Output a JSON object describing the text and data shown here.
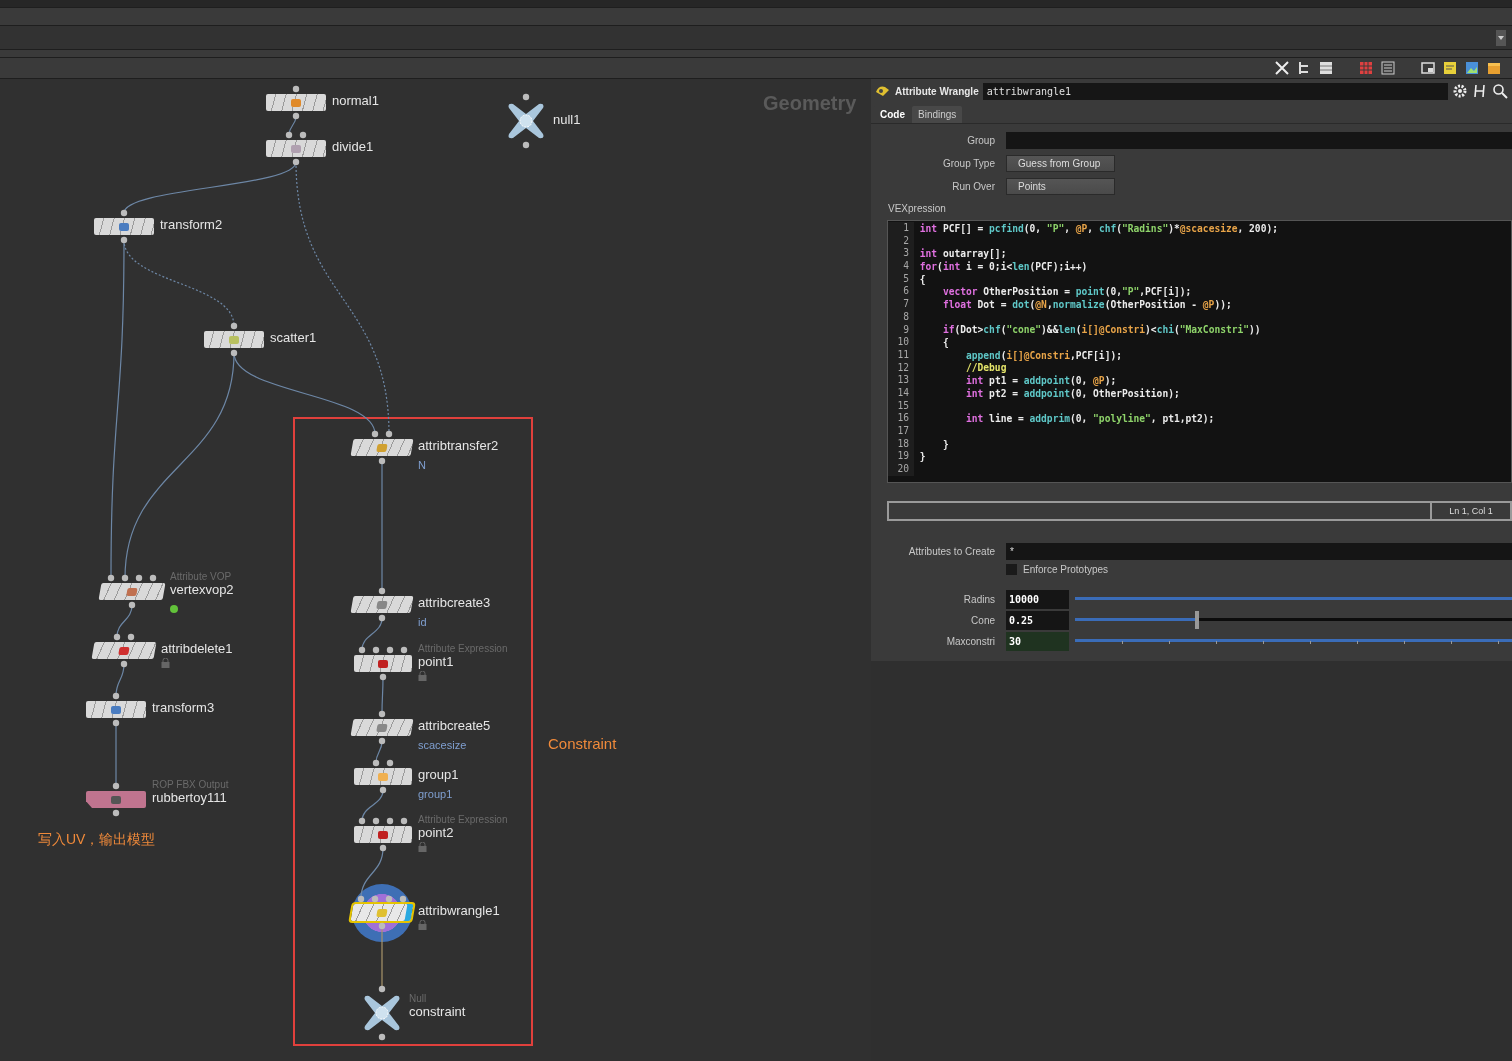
{
  "network": {
    "context": "Geometry",
    "box_label": "Constraint",
    "sticky_note": "写入UV，输出模型",
    "nodes": [
      {
        "name": "normal1",
        "kind": "box",
        "selected": false,
        "locked": false
      },
      {
        "name": "divide1",
        "kind": "box",
        "selected": false,
        "locked": false
      },
      {
        "name": "null1",
        "kind": "null",
        "selected": false,
        "locked": false
      },
      {
        "name": "transform2",
        "kind": "box",
        "selected": false,
        "locked": false
      },
      {
        "name": "scatter1",
        "kind": "box",
        "selected": false,
        "locked": false
      },
      {
        "name": "attribtransfer2",
        "kind": "slanted",
        "note": "N",
        "selected": false,
        "locked": false
      },
      {
        "name": "vertexvop2",
        "type": "Attribute VOP",
        "kind": "slanted",
        "badge": true,
        "selected": false,
        "locked": false
      },
      {
        "name": "attribdelete1",
        "kind": "slanted",
        "selected": false,
        "locked": true
      },
      {
        "name": "transform3",
        "kind": "box",
        "selected": false,
        "locked": false
      },
      {
        "name": "rubbertoy111",
        "type": "ROP FBX Output",
        "kind": "rop",
        "selected": false,
        "locked": false
      },
      {
        "name": "attribcreate3",
        "kind": "slanted",
        "note": "id",
        "selected": false,
        "locked": false
      },
      {
        "name": "point1",
        "type": "Attribute Expression",
        "kind": "box",
        "selected": false,
        "locked": true
      },
      {
        "name": "attribcreate5",
        "kind": "slanted",
        "note": "scacesize",
        "selected": false,
        "locked": false
      },
      {
        "name": "group1",
        "kind": "box",
        "note": "group1",
        "selected": false,
        "locked": false
      },
      {
        "name": "point2",
        "type": "Attribute Expression",
        "kind": "box",
        "selected": false,
        "locked": true
      },
      {
        "name": "attribwrangle1",
        "kind": "slanted",
        "selected": true,
        "locked": true
      },
      {
        "name": "constraint",
        "type": "Null",
        "kind": "null",
        "selected": false,
        "locked": false
      }
    ]
  },
  "parameters": {
    "node_type": "Attribute Wrangle",
    "node_name": "attribwrangle1",
    "tabs": [
      {
        "label": "Code",
        "selected": true
      },
      {
        "label": "Bindings",
        "selected": false
      }
    ],
    "group": {
      "label": "Group"
    },
    "group_type": {
      "label": "Group Type",
      "value": "Guess from Group"
    },
    "run_over": {
      "label": "Run Over",
      "value": "Points"
    },
    "vex_label": "VEXpression",
    "code_lines": [
      {
        "number": "1",
        "tokens": [
          {
            "kind": "keyword",
            "text": "int"
          },
          {
            "kind": "plain",
            "text": " PCF[] = "
          },
          {
            "kind": "function",
            "text": "pcfind"
          },
          {
            "kind": "plain",
            "text": "(0, "
          },
          {
            "kind": "string",
            "text": "\"P\""
          },
          {
            "kind": "plain",
            "text": ", "
          },
          {
            "kind": "attribute",
            "text": "@P"
          },
          {
            "kind": "plain",
            "text": ", "
          },
          {
            "kind": "function",
            "text": "chf"
          },
          {
            "kind": "plain",
            "text": "("
          },
          {
            "kind": "string",
            "text": "\"Radins\""
          },
          {
            "kind": "plain",
            "text": ")*"
          },
          {
            "kind": "attribute",
            "text": "@scacesize"
          },
          {
            "kind": "plain",
            "text": ", 200);"
          }
        ]
      },
      {
        "number": "2"
      },
      {
        "number": "3",
        "tokens": [
          {
            "kind": "keyword",
            "text": "int"
          },
          {
            "kind": "plain",
            "text": " outarray[];"
          }
        ]
      },
      {
        "number": "4",
        "tokens": [
          {
            "kind": "keyword",
            "text": "for"
          },
          {
            "kind": "plain",
            "text": "("
          },
          {
            "kind": "keyword",
            "text": "int"
          },
          {
            "kind": "plain",
            "text": " i = 0;i<"
          },
          {
            "kind": "function",
            "text": "len"
          },
          {
            "kind": "plain",
            "text": "(PCF);i++)"
          }
        ]
      },
      {
        "number": "5",
        "tokens": [
          {
            "kind": "plain",
            "text": "{"
          }
        ]
      },
      {
        "number": "6",
        "tokens": [
          {
            "kind": "keyword",
            "text": "    vector"
          },
          {
            "kind": "plain",
            "text": " OtherPosition = "
          },
          {
            "kind": "function",
            "text": "point"
          },
          {
            "kind": "plain",
            "text": "(0,"
          },
          {
            "kind": "string",
            "text": "\"P\""
          },
          {
            "kind": "plain",
            "text": ",PCF[i]);"
          }
        ]
      },
      {
        "number": "7",
        "tokens": [
          {
            "kind": "keyword",
            "text": "    float"
          },
          {
            "kind": "plain",
            "text": " Dot = "
          },
          {
            "kind": "function",
            "text": "dot"
          },
          {
            "kind": "plain",
            "text": "("
          },
          {
            "kind": "attribute",
            "text": "@N"
          },
          {
            "kind": "plain",
            "text": ","
          },
          {
            "kind": "function",
            "text": "normalize"
          },
          {
            "kind": "plain",
            "text": "(OtherPosition - "
          },
          {
            "kind": "attribute",
            "text": "@P"
          },
          {
            "kind": "plain",
            "text": "));"
          }
        ]
      },
      {
        "number": "8"
      },
      {
        "number": "9",
        "tokens": [
          {
            "kind": "keyword",
            "text": "    if"
          },
          {
            "kind": "plain",
            "text": "(Dot>"
          },
          {
            "kind": "function",
            "text": "chf"
          },
          {
            "kind": "plain",
            "text": "("
          },
          {
            "kind": "string",
            "text": "\"cone\""
          },
          {
            "kind": "plain",
            "text": ")&&"
          },
          {
            "kind": "function",
            "text": "len"
          },
          {
            "kind": "plain",
            "text": "("
          },
          {
            "kind": "attribute",
            "text": "i[]@Constri"
          },
          {
            "kind": "plain",
            "text": ")<"
          },
          {
            "kind": "function",
            "text": "chi"
          },
          {
            "kind": "plain",
            "text": "("
          },
          {
            "kind": "string",
            "text": "\"MaxConstri\""
          },
          {
            "kind": "plain",
            "text": "))"
          }
        ]
      },
      {
        "number": "10",
        "tokens": [
          {
            "kind": "plain",
            "text": "    {"
          }
        ]
      },
      {
        "number": "11",
        "tokens": [
          {
            "kind": "function",
            "text": "        append"
          },
          {
            "kind": "plain",
            "text": "("
          },
          {
            "kind": "attribute",
            "text": "i[]@Constri"
          },
          {
            "kind": "plain",
            "text": ",PCF[i]);"
          }
        ]
      },
      {
        "number": "12",
        "tokens": [
          {
            "kind": "comment",
            "text": "        //Debug"
          }
        ]
      },
      {
        "number": "13",
        "tokens": [
          {
            "kind": "keyword",
            "text": "        int"
          },
          {
            "kind": "plain",
            "text": " pt1 = "
          },
          {
            "kind": "function",
            "text": "addpoint"
          },
          {
            "kind": "plain",
            "text": "(0, "
          },
          {
            "kind": "attribute",
            "text": "@P"
          },
          {
            "kind": "plain",
            "text": ");"
          }
        ]
      },
      {
        "number": "14",
        "tokens": [
          {
            "kind": "keyword",
            "text": "        int"
          },
          {
            "kind": "plain",
            "text": " pt2 = "
          },
          {
            "kind": "function",
            "text": "addpoint"
          },
          {
            "kind": "plain",
            "text": "(0, OtherPosition);"
          }
        ]
      },
      {
        "number": "15"
      },
      {
        "number": "16",
        "tokens": [
          {
            "kind": "keyword",
            "text": "        int"
          },
          {
            "kind": "plain",
            "text": " line = "
          },
          {
            "kind": "function",
            "text": "addprim"
          },
          {
            "kind": "plain",
            "text": "(0, "
          },
          {
            "kind": "string",
            "text": "\"polyline\""
          },
          {
            "kind": "plain",
            "text": ", pt1,pt2);"
          }
        ]
      },
      {
        "number": "17"
      },
      {
        "number": "18",
        "tokens": [
          {
            "kind": "plain",
            "text": "    }"
          }
        ]
      },
      {
        "number": "19",
        "tokens": [
          {
            "kind": "plain",
            "text": "}"
          }
        ]
      },
      {
        "number": "20"
      }
    ],
    "cursor_position": "Ln 1, Col 1",
    "attributes_to_create": {
      "label": "Attributes to Create",
      "value": "*"
    },
    "enforce_prototypes": {
      "label": "Enforce Prototypes",
      "checked": false
    },
    "sliders": [
      {
        "label": "Radins",
        "value": "10000",
        "level": 1,
        "kind": "float"
      },
      {
        "label": "Cone",
        "value": "0.25",
        "level": 0.27,
        "kind": "float"
      },
      {
        "label": "Maxconstri",
        "value": "30",
        "level": 1,
        "kind": "int"
      }
    ]
  }
}
